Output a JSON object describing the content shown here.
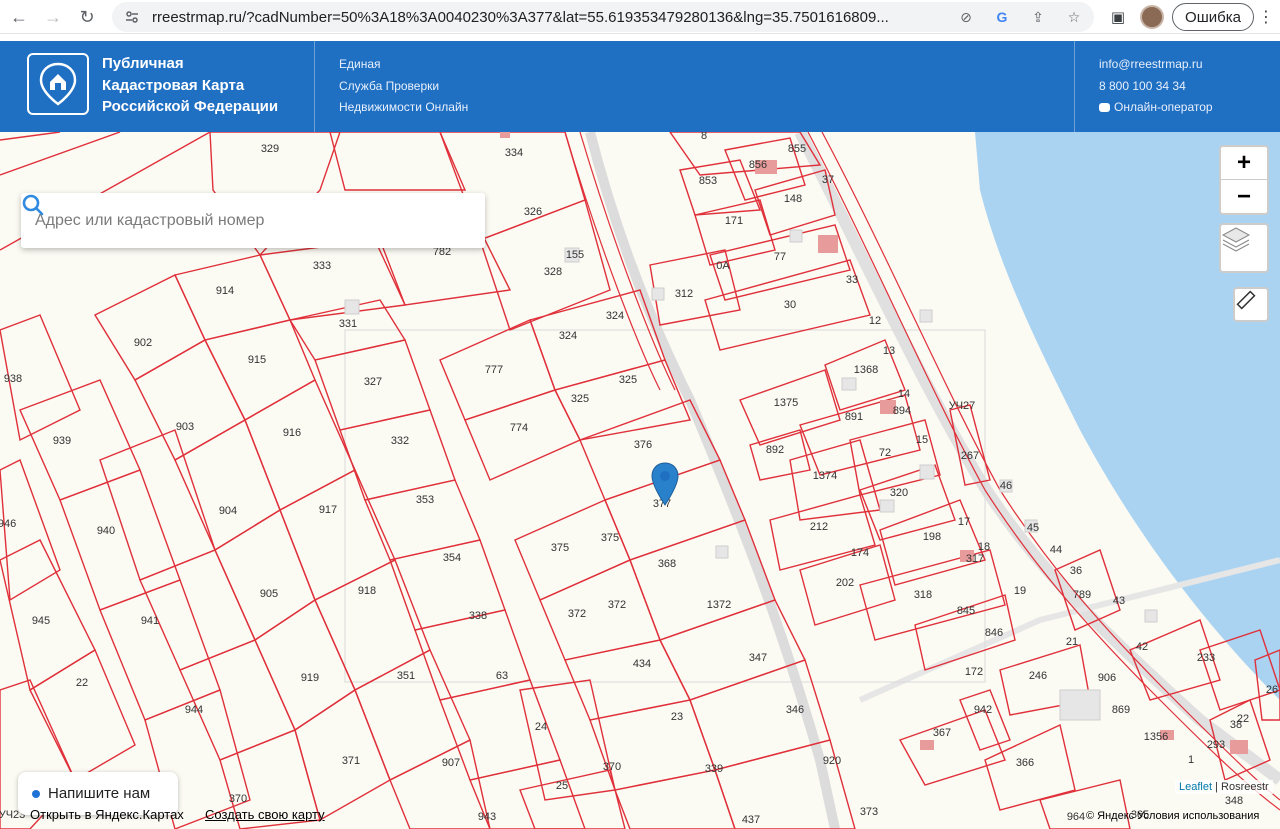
{
  "browser": {
    "url": "rreestrmap.ru/?cadNumber=50%3A18%3A0040230%3A377&lat=55.619353479280136&lng=35.7501616809...",
    "error_label": "Ошибка"
  },
  "header": {
    "brand_line1": "Публичная",
    "brand_line2": "Кадастровая Карта",
    "brand_line3": "Российской Федерации",
    "service_line1": "Единая",
    "service_line2": "Служба Проверки",
    "service_line3": "Недвижимости Онлайн",
    "email": "info@rreestrmap.ru",
    "phone": "8 800 100 34 34",
    "operator": "Онлайн-оператор"
  },
  "search": {
    "placeholder": "Адрес или кадастровый номер"
  },
  "map": {
    "zoom_in": "+",
    "zoom_out": "−",
    "selected_parcel": "377",
    "parcel_labels": [
      "329",
      "334",
      "8",
      "856",
      "855",
      "853",
      "37",
      "148",
      "171",
      "326",
      "782",
      "155",
      "333",
      "914",
      "331",
      "328",
      "0A",
      "77",
      "312",
      "33",
      "30",
      "12",
      "324",
      "324",
      "13",
      "902",
      "915",
      "327",
      "777",
      "325",
      "1368",
      "938",
      "1375",
      "14",
      "891",
      "894",
      "УЧ27",
      "325",
      "774",
      "332",
      "939",
      "903",
      "916",
      "376",
      "892",
      "72",
      "15",
      "267",
      "1374",
      "46",
      "320",
      "377",
      "353",
      "917",
      "946",
      "940",
      "904",
      "375",
      "375",
      "212",
      "17",
      "45",
      "198",
      "354",
      "368",
      "1372",
      "18",
      "44",
      "202",
      "174",
      "317",
      "36",
      "918",
      "372",
      "372",
      "789",
      "905",
      "338",
      "318",
      "19",
      "43",
      "845",
      "846",
      "941",
      "945",
      "21",
      "42",
      "233",
      "246",
      "172",
      "63",
      "434",
      "347",
      "351",
      "919",
      "906",
      "22",
      "944",
      "942",
      "869",
      "23",
      "346",
      "367",
      "1356",
      "24",
      "371",
      "907",
      "920",
      "339",
      "366",
      "1",
      "25",
      "370",
      "370",
      "943",
      "437",
      "373",
      "348",
      "26",
      "38",
      "293",
      "22",
      "УЧ23",
      "964",
      "365",
      "2"
    ],
    "chat_label": "Напишите нам",
    "open_in_yandex": "Открыть в Яндекс.Картах",
    "create_map": "Создать свою карту",
    "attribution_leaflet": "Leaflet",
    "attribution_source": "Rosreestr",
    "yandex_terms": "© Яндекс Условия использования"
  }
}
